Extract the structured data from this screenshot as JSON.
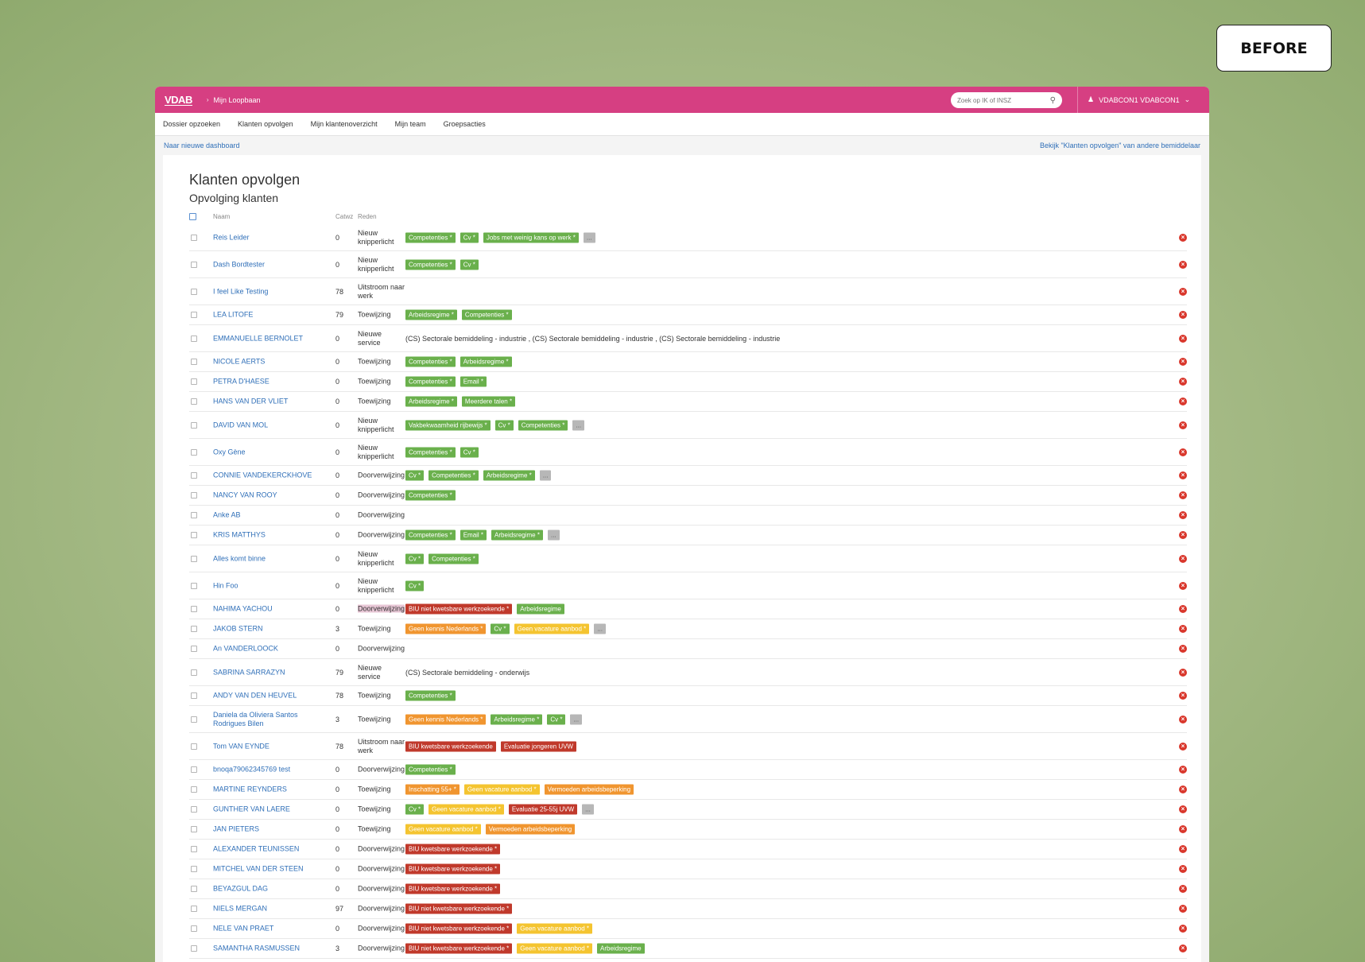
{
  "badge": "BEFORE",
  "topbar": {
    "logo": "VDAB",
    "breadcrumb": "Mijn Loopbaan",
    "search_placeholder": "Zoek op IK of INSZ",
    "user": "VDABCON1 VDABCON1"
  },
  "nav": [
    "Dossier opzoeken",
    "Klanten opvolgen",
    "Mijn klantenoverzicht",
    "Mijn team",
    "Groepsacties"
  ],
  "subnav": {
    "left": "Naar nieuwe dashboard",
    "right": "Bekijk \"Klanten opvolgen\" van andere bemiddelaar"
  },
  "page": {
    "title": "Klanten opvolgen",
    "subtitle": "Opvolging klanten",
    "columns": {
      "naam": "Naam",
      "catwz": "Catwz",
      "reden": "Reden"
    }
  },
  "colors": {
    "topbar": "#d63f82",
    "link": "#2f6fb8",
    "green": "#6ab04c",
    "red": "#c0392b",
    "orange": "#f0952f",
    "yellow": "#f4c430"
  },
  "rows": [
    {
      "name": "Reis Leider",
      "catwz": "0",
      "reden": "Nieuw knipperlicht",
      "h": 34,
      "tags": [
        [
          "Competenties *",
          "green"
        ],
        [
          "Cv *",
          "green"
        ],
        [
          "Jobs met weinig kans op werk *",
          "green"
        ],
        [
          "...",
          "gray"
        ]
      ]
    },
    {
      "name": "Dash Bordtester",
      "catwz": "0",
      "reden": "Nieuw knipperlicht",
      "h": 34,
      "tags": [
        [
          "Competenties *",
          "green"
        ],
        [
          "Cv *",
          "green"
        ]
      ]
    },
    {
      "name": "I feel Like Testing",
      "catwz": "78",
      "reden": "Uitstroom naar werk",
      "h": 34,
      "tags": []
    },
    {
      "name": "LEA LITOFE",
      "catwz": "79",
      "reden": "Toewijzing",
      "h": 25,
      "tags": [
        [
          "Arbeidsregime *",
          "green"
        ],
        [
          "Competenties *",
          "green"
        ]
      ]
    },
    {
      "name": "EMMANUELLE BERNOLET",
      "catwz": "0",
      "reden": "Nieuwe service",
      "h": 34,
      "text": "(CS) Sectorale bemiddeling - industrie , (CS) Sectorale bemiddeling - industrie , (CS) Sectorale bemiddeling - industrie"
    },
    {
      "name": "NICOLE AERTS",
      "catwz": "0",
      "reden": "Toewijzing",
      "h": 25,
      "tags": [
        [
          "Competenties *",
          "green"
        ],
        [
          "Arbeidsregime *",
          "green"
        ]
      ]
    },
    {
      "name": "PETRA D'HAESE",
      "catwz": "0",
      "reden": "Toewijzing",
      "h": 25,
      "tags": [
        [
          "Competenties *",
          "green"
        ],
        [
          "Email *",
          "green"
        ]
      ]
    },
    {
      "name": "HANS VAN DER VLIET",
      "catwz": "0",
      "reden": "Toewijzing",
      "h": 25,
      "tags": [
        [
          "Arbeidsregime *",
          "green"
        ],
        [
          "Meerdere talen *",
          "green"
        ]
      ]
    },
    {
      "name": "DAVID VAN MOL",
      "catwz": "0",
      "reden": "Nieuw knipperlicht",
      "h": 34,
      "tags": [
        [
          "Vakbekwaamheid rijbewijs *",
          "green"
        ],
        [
          "Cv *",
          "green"
        ],
        [
          "Competenties *",
          "green"
        ],
        [
          "...",
          "gray"
        ]
      ]
    },
    {
      "name": "Oxy Gène",
      "catwz": "0",
      "reden": "Nieuw knipperlicht",
      "h": 34,
      "tags": [
        [
          "Competenties *",
          "green"
        ],
        [
          "Cv *",
          "green"
        ]
      ]
    },
    {
      "name": "CONNIE VANDEKERCKHOVE",
      "catwz": "0",
      "reden": "Doorverwijzing",
      "h": 25,
      "tags": [
        [
          "Cv *",
          "green"
        ],
        [
          "Competenties *",
          "green"
        ],
        [
          "Arbeidsregime *",
          "green"
        ],
        [
          "...",
          "gray"
        ]
      ]
    },
    {
      "name": "NANCY VAN ROOY",
      "catwz": "0",
      "reden": "Doorverwijzing",
      "h": 25,
      "tags": [
        [
          "Competenties *",
          "green"
        ]
      ]
    },
    {
      "name": "Anke AB",
      "catwz": "0",
      "reden": "Doorverwijzing",
      "h": 25,
      "tags": []
    },
    {
      "name": "KRIS MATTHYS",
      "catwz": "0",
      "reden": "Doorverwijzing",
      "h": 25,
      "tags": [
        [
          "Competenties *",
          "green"
        ],
        [
          "Email *",
          "green"
        ],
        [
          "Arbeidsregime *",
          "green"
        ],
        [
          "...",
          "gray"
        ]
      ]
    },
    {
      "name": "Alles komt binne",
      "catwz": "0",
      "reden": "Nieuw knipperlicht",
      "h": 34,
      "tags": [
        [
          "Cv *",
          "green"
        ],
        [
          "Competenties *",
          "green"
        ]
      ]
    },
    {
      "name": "Hin Foo",
      "catwz": "0",
      "reden": "Nieuw knipperlicht",
      "h": 34,
      "tags": [
        [
          "Cv *",
          "green"
        ]
      ]
    },
    {
      "name": "NAHIMA YACHOU",
      "catwz": "0",
      "reden": "Doorverwijzing",
      "h": 25,
      "highlight": true,
      "tags": [
        [
          "BIU niet kwetsbare werkzoekende *",
          "red"
        ],
        [
          "Arbeidsregime",
          "green"
        ]
      ]
    },
    {
      "name": "JAKOB STERN",
      "catwz": "3",
      "reden": "Toewijzing",
      "h": 25,
      "tags": [
        [
          "Geen kennis Nederlands *",
          "orange"
        ],
        [
          "Cv *",
          "green"
        ],
        [
          "Geen vacature aanbod *",
          "yellow"
        ],
        [
          "...",
          "gray"
        ]
      ]
    },
    {
      "name": "An VANDERLOOCK",
      "catwz": "0",
      "reden": "Doorverwijzing",
      "h": 25,
      "tags": []
    },
    {
      "name": "SABRINA SARRAZYN",
      "catwz": "79",
      "reden": "Nieuwe service",
      "h": 34,
      "text": "(CS) Sectorale bemiddeling - onderwijs"
    },
    {
      "name": "ANDY VAN DEN HEUVEL",
      "catwz": "78",
      "reden": "Toewijzing",
      "h": 25,
      "tags": [
        [
          "Competenties *",
          "green"
        ]
      ]
    },
    {
      "name": "Daniela da Oliviera Santos Rodrigues Bilen",
      "catwz": "3",
      "reden": "Toewijzing",
      "h": 34,
      "tags": [
        [
          "Geen kennis Nederlands *",
          "orange"
        ],
        [
          "Arbeidsregime *",
          "green"
        ],
        [
          "Cv *",
          "green"
        ],
        [
          "...",
          "gray"
        ]
      ]
    },
    {
      "name": "Tom VAN EYNDE",
      "catwz": "78",
      "reden": "Uitstroom naar werk",
      "h": 34,
      "tags": [
        [
          "BIU kwetsbare werkzoekende",
          "red"
        ],
        [
          "Evaluatie jongeren UVW",
          "red"
        ]
      ]
    },
    {
      "name": "bnoqa79062345769 test",
      "catwz": "0",
      "reden": "Doorverwijzing",
      "h": 25,
      "tags": [
        [
          "Competenties *",
          "green"
        ]
      ]
    },
    {
      "name": "MARTINE REYNDERS",
      "catwz": "0",
      "reden": "Toewijzing",
      "h": 25,
      "tags": [
        [
          "Inschatting 55+ *",
          "orange"
        ],
        [
          "Geen vacature aanbod *",
          "yellow"
        ],
        [
          "Vermoeden arbeidsbeperking",
          "orange"
        ]
      ]
    },
    {
      "name": "GUNTHER VAN LAERE",
      "catwz": "0",
      "reden": "Toewijzing",
      "h": 25,
      "tags": [
        [
          "Cv *",
          "green"
        ],
        [
          "Geen vacature aanbod *",
          "yellow"
        ],
        [
          "Evaluatie 25-55j UVW",
          "red"
        ],
        [
          "...",
          "gray"
        ]
      ]
    },
    {
      "name": "JAN PIETERS",
      "catwz": "0",
      "reden": "Toewijzing",
      "h": 25,
      "tags": [
        [
          "Geen vacature aanbod *",
          "yellow"
        ],
        [
          "Vermoeden arbeidsbeperking",
          "orange"
        ]
      ]
    },
    {
      "name": "ALEXANDER TEUNISSEN",
      "catwz": "0",
      "reden": "Doorverwijzing",
      "h": 25,
      "tags": [
        [
          "BIU kwetsbare werkzoekende *",
          "red"
        ]
      ]
    },
    {
      "name": "MITCHEL VAN DER STEEN",
      "catwz": "0",
      "reden": "Doorverwijzing",
      "h": 25,
      "tags": [
        [
          "BIU kwetsbare werkzoekende *",
          "red"
        ]
      ]
    },
    {
      "name": "BEYAZGUL DAG",
      "catwz": "0",
      "reden": "Doorverwijzing",
      "h": 25,
      "tags": [
        [
          "BIU kwetsbare werkzoekende *",
          "red"
        ]
      ]
    },
    {
      "name": "NIELS MERGAN",
      "catwz": "97",
      "reden": "Doorverwijzing",
      "h": 25,
      "tags": [
        [
          "BIU niet kwetsbare werkzoekende *",
          "red"
        ]
      ]
    },
    {
      "name": "NELE VAN PRAET",
      "catwz": "0",
      "reden": "Doorverwijzing",
      "h": 25,
      "tags": [
        [
          "BIU niet kwetsbare werkzoekende *",
          "red"
        ],
        [
          "Geen vacature aanbod *",
          "yellow"
        ]
      ]
    },
    {
      "name": "SAMANTHA RASMUSSEN",
      "catwz": "3",
      "reden": "Doorverwijzing",
      "h": 25,
      "tags": [
        [
          "BIU niet kwetsbare werkzoekende *",
          "red"
        ],
        [
          "Geen vacature aanbod *",
          "yellow"
        ],
        [
          "Arbeidsregime",
          "green"
        ]
      ]
    }
  ]
}
